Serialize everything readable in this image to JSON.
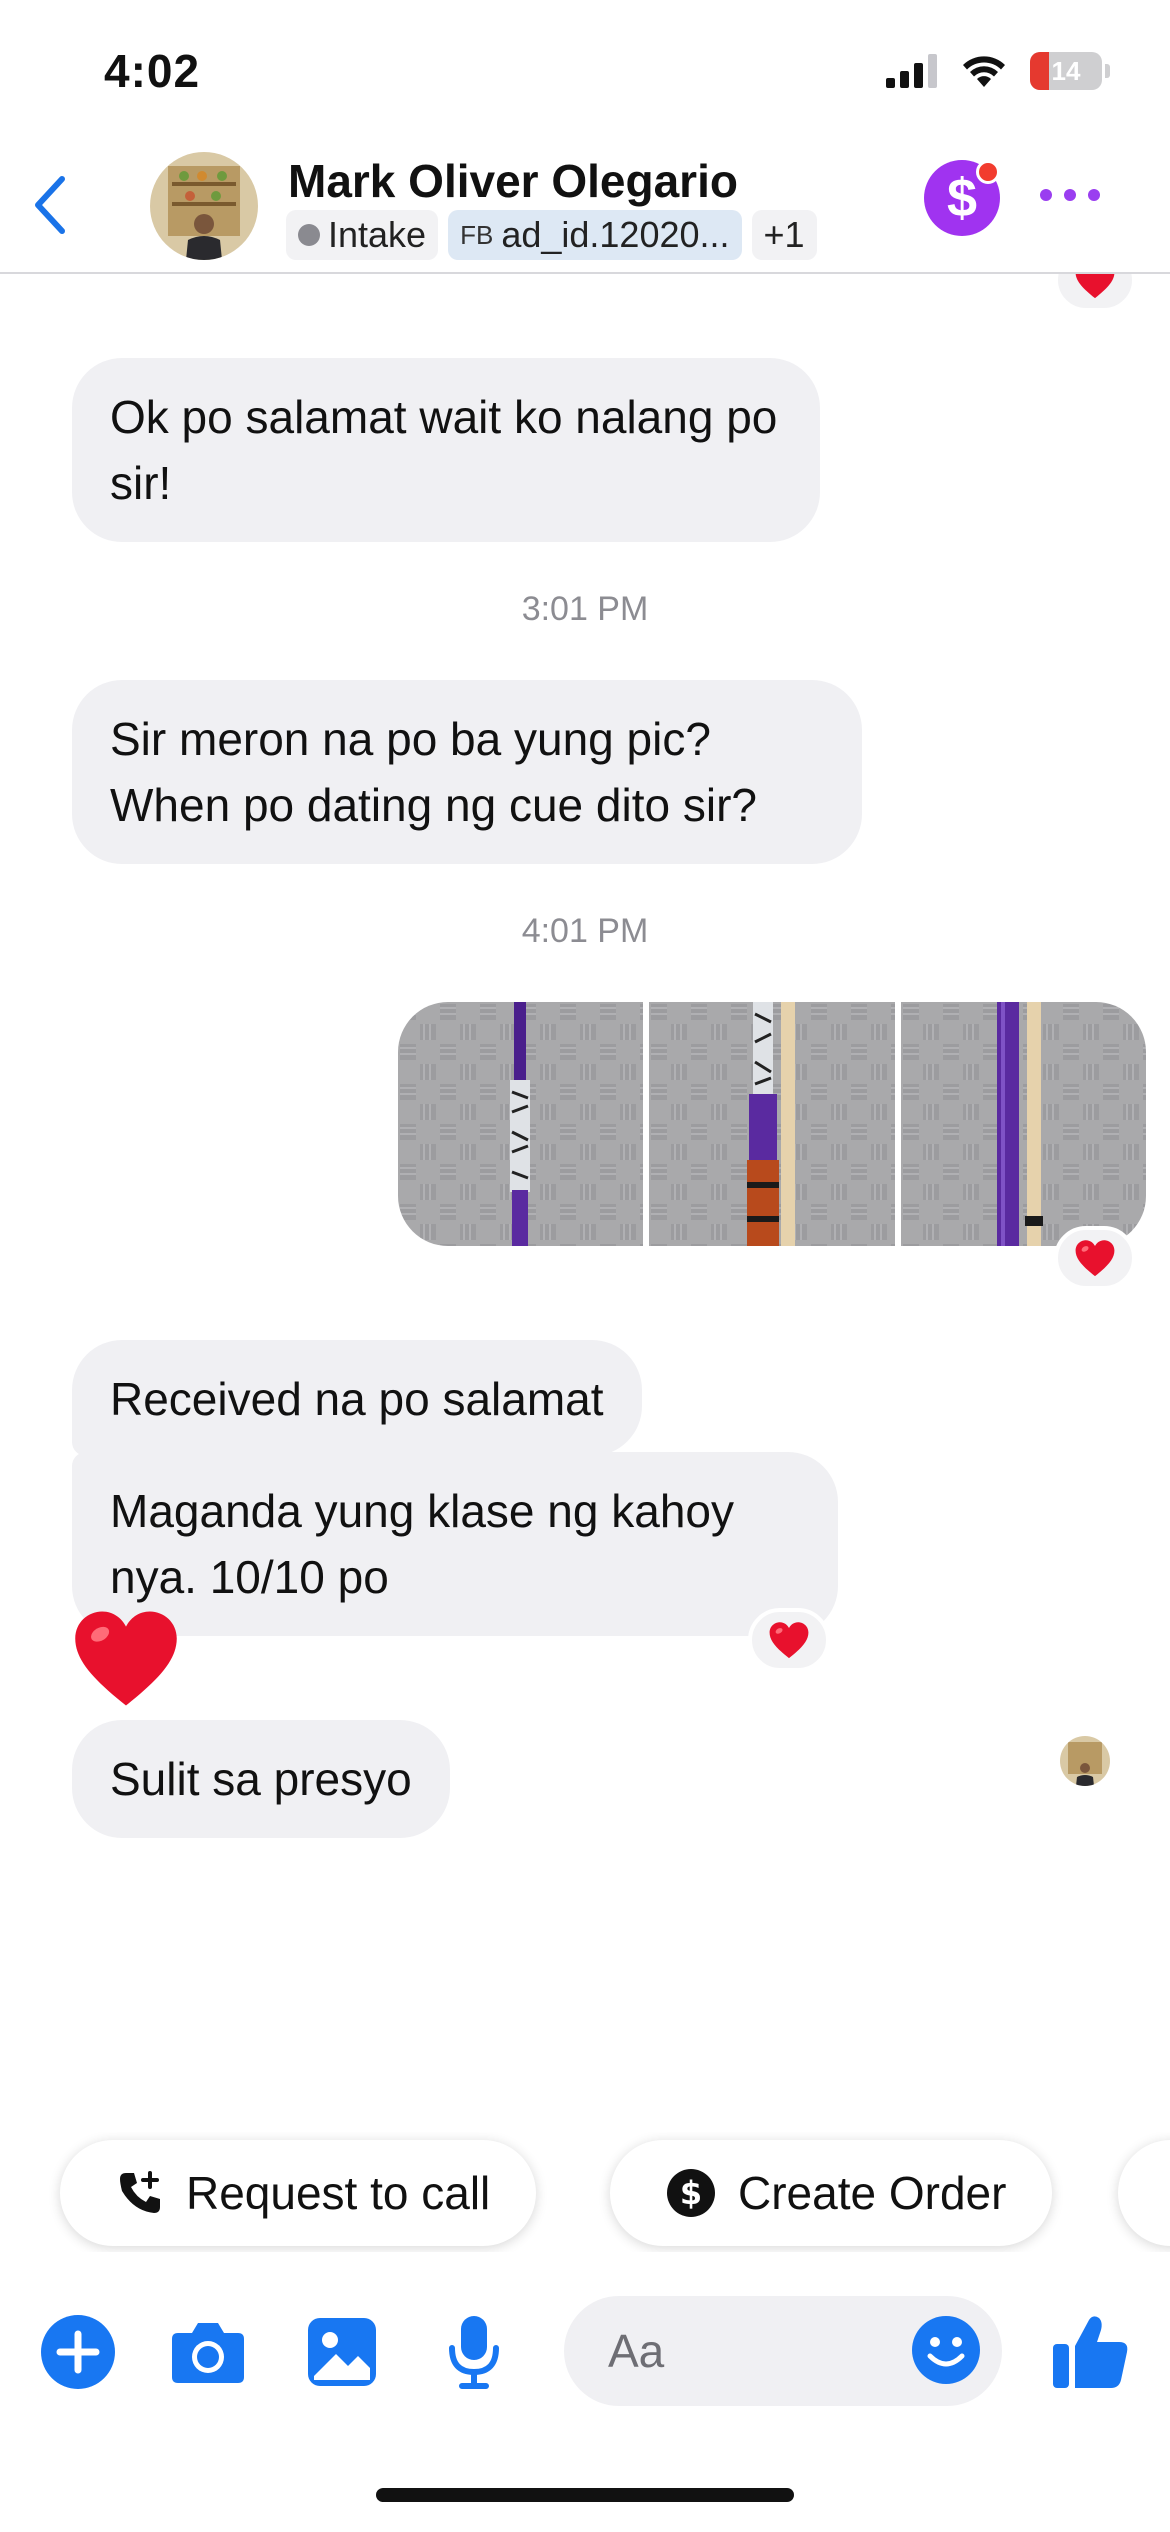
{
  "status_bar": {
    "time": "4:02",
    "battery": "14"
  },
  "header": {
    "back_icon": "chevron-left-icon",
    "contact_name": "Mark Oliver Olegario",
    "tags": [
      {
        "label": "Intake"
      },
      {
        "prefix": "FB",
        "label": "ad_id.12020..."
      },
      {
        "label": "+1"
      }
    ],
    "payment_icon": "dollar-icon",
    "more_icon": "more-icon",
    "accent_color": "#a033f0"
  },
  "messages": [
    {
      "sender": "contact",
      "text": "Ok po salamat wait ko nalang po sir!"
    },
    {
      "type": "timestamp",
      "text": "3:01 PM"
    },
    {
      "sender": "contact",
      "text": "Sir meron na po ba yung pic? When po dating ng cue dito sir?"
    },
    {
      "type": "timestamp",
      "text": "4:01 PM"
    },
    {
      "sender": "me",
      "type": "photos",
      "count": 3,
      "reaction": "heart"
    },
    {
      "sender": "contact",
      "text": "Received na po salamat"
    },
    {
      "sender": "contact",
      "text": "Maganda yung klase ng kahoy nya. 10/10 po",
      "reaction": "heart"
    },
    {
      "sender": "contact",
      "text": "Sulit sa presyo"
    },
    {
      "sender": "contact",
      "type": "emoji",
      "emoji": "heart"
    }
  ],
  "quick_replies": [
    {
      "label": "Request to call",
      "icon": "phone-plus-icon"
    },
    {
      "label": "Create Order",
      "icon": "dollar-circle-icon"
    }
  ],
  "composer": {
    "placeholder": "Aa",
    "icons": [
      "plus-icon",
      "camera-icon",
      "image-icon",
      "microphone-icon",
      "emoji-icon",
      "thumbs-up-icon"
    ],
    "accent_color": "#1877f2"
  }
}
